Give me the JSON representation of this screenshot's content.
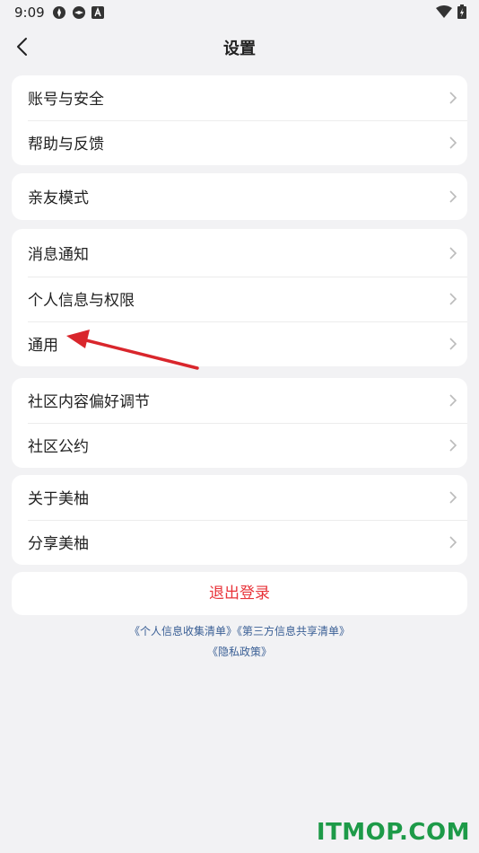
{
  "status_bar": {
    "time": "9:09"
  },
  "nav": {
    "title": "设置"
  },
  "groups": [
    {
      "items": [
        "账号与安全",
        "帮助与反馈"
      ]
    },
    {
      "items": [
        "亲友模式"
      ]
    },
    {
      "items": [
        "消息通知",
        "个人信息与权限",
        "通用"
      ]
    },
    {
      "items": [
        "社区内容偏好调节",
        "社区公约"
      ]
    },
    {
      "items": [
        "关于美柚",
        "分享美柚"
      ]
    }
  ],
  "logout_label": "退出登录",
  "links": {
    "personal_info_list": "《个人信息收集清单》",
    "third_party_share_list": "《第三方信息共享清单》",
    "privacy_policy": "《隐私政策》"
  },
  "watermark": "ITMOP.COM",
  "colors": {
    "accent_red": "#e8343a",
    "link_blue": "#3a5f95",
    "watermark_green": "#1d9a48"
  }
}
